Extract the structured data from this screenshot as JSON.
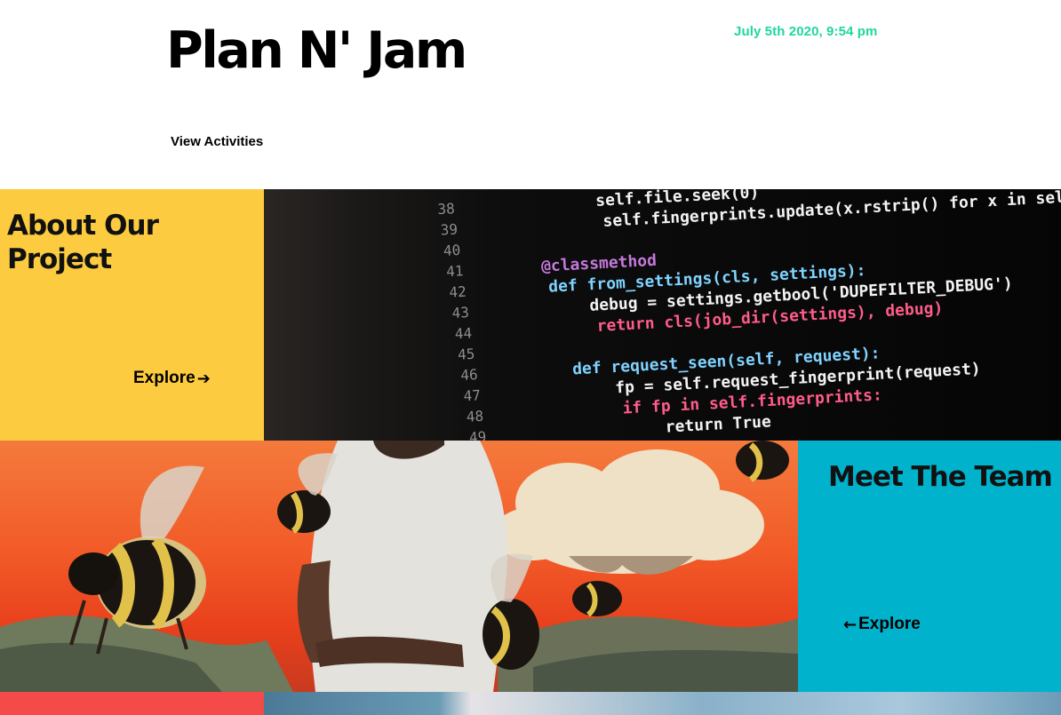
{
  "header": {
    "title": "Plan N' Jam",
    "datetime": "July 5th 2020, 9:54 pm",
    "nav_link": "View Activities"
  },
  "about": {
    "heading": "About Our Project",
    "explore_label": "Explore",
    "explore_icon": "arrow-right-icon"
  },
  "team": {
    "heading": "Meet The Team",
    "explore_label": "Explore",
    "explore_icon": "arrow-left-icon"
  },
  "code_image": {
    "line_numbers": [
      "38",
      "39",
      "40",
      "41",
      "42",
      "43",
      "44",
      "45",
      "46",
      "47",
      "48",
      "49"
    ],
    "lines": [
      "self.file.seek(0)",
      "self.fingerprints.update(x.rstrip() for x in self.file)",
      "",
      "@classmethod",
      "def from_settings(cls, settings):",
      "debug = settings.getbool('DUPEFILTER_DEBUG')",
      "return cls(job_dir(settings), debug)",
      "",
      "def request_seen(self, request):",
      "fp = self.request_fingerprint(request)",
      "if fp in self.fingerprints:",
      "return True"
    ]
  },
  "colors": {
    "accent_date": "#1fd7a0",
    "yellow_panel": "#fdcb3f",
    "teal_panel": "#00b2cc",
    "red_strip": "#f44a4a"
  }
}
